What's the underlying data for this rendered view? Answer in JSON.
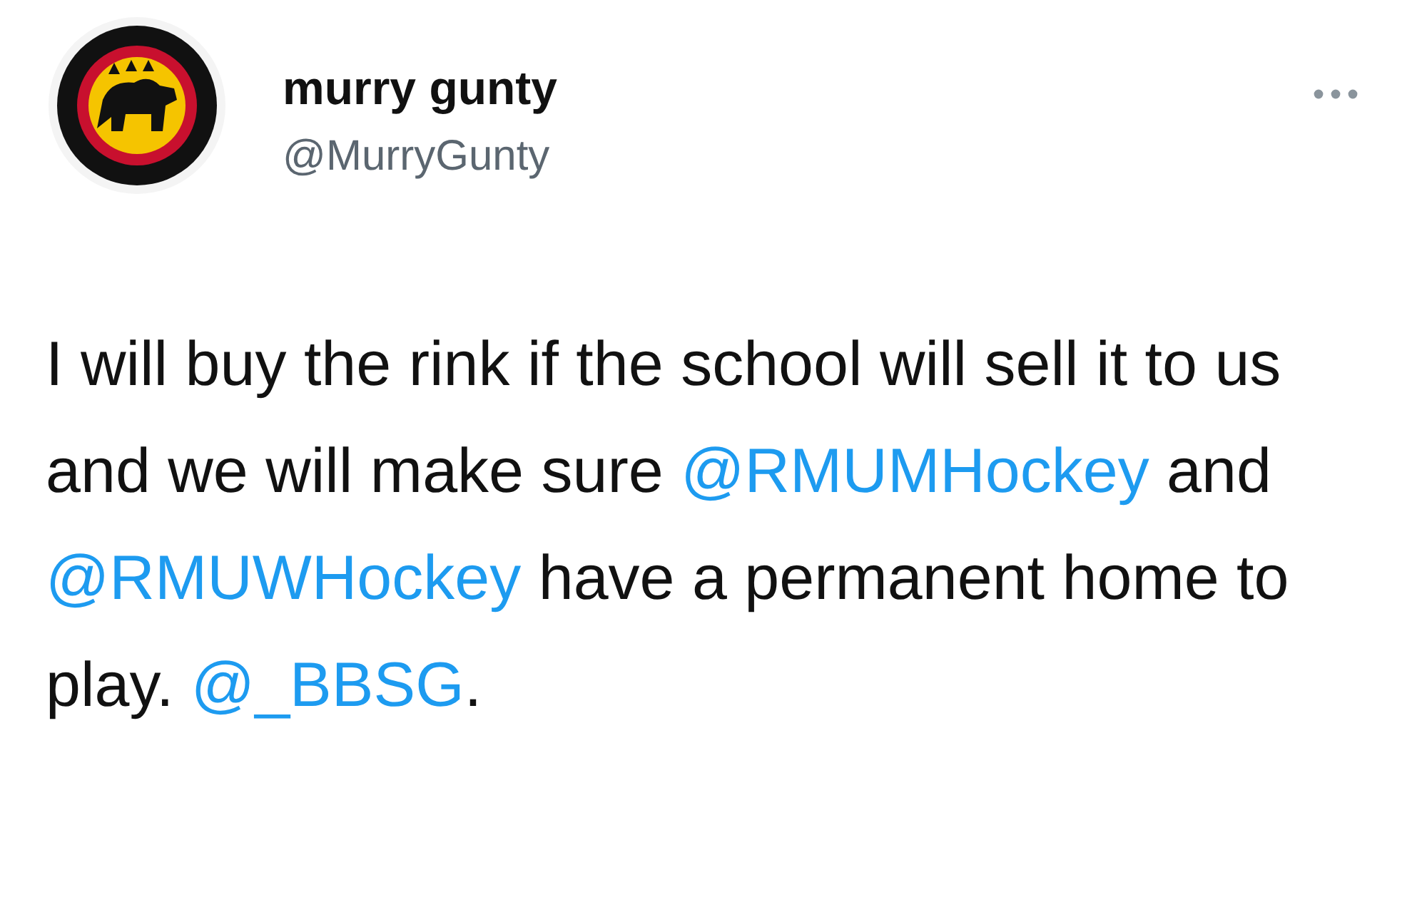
{
  "author": {
    "name": "murry gunty",
    "handle": "@MurryGunty"
  },
  "tweet": {
    "segments": [
      {
        "kind": "text",
        "text": "I will buy the rink if the school will sell it to us and we will make sure "
      },
      {
        "kind": "mention",
        "text": "@RMUMHockey"
      },
      {
        "kind": "text",
        "text": " and "
      },
      {
        "kind": "mention",
        "text": "@RMUWHockey"
      },
      {
        "kind": "text",
        "text": " have a permanent home to play. "
      },
      {
        "kind": "mention",
        "text": "@_BBSG"
      },
      {
        "kind": "text",
        "text": "."
      }
    ]
  }
}
